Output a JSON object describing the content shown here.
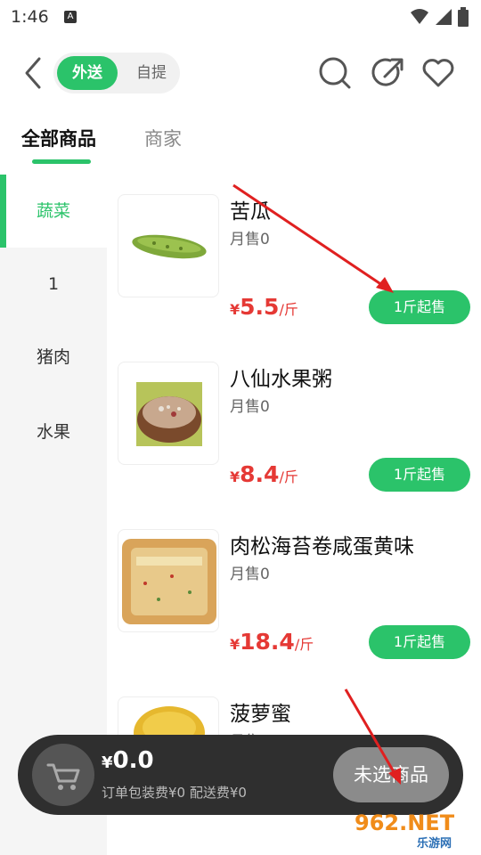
{
  "status_bar": {
    "time": "1:46",
    "notification_icon": "A",
    "icons": [
      "wifi-icon",
      "signal-icon",
      "battery-icon"
    ]
  },
  "header": {
    "toggle": {
      "active_label": "外送",
      "inactive_label": "自提"
    },
    "icons": [
      "back-icon",
      "search-icon",
      "share-icon",
      "heart-icon"
    ]
  },
  "tabs": {
    "all_goods": "全部商品",
    "merchant": "商家"
  },
  "sidebar": {
    "categories": [
      {
        "label": "蔬菜",
        "active": true
      },
      {
        "label": "1",
        "active": false
      },
      {
        "label": "猪肉",
        "active": false
      },
      {
        "label": "水果",
        "active": false
      }
    ]
  },
  "products": [
    {
      "name": "苦瓜",
      "sales": "月售0",
      "price_symbol": "¥",
      "price": "5.5",
      "unit": "/斤",
      "button": "1斤起售"
    },
    {
      "name": "八仙水果粥",
      "sales": "月售0",
      "price_symbol": "¥",
      "price": "8.4",
      "unit": "/斤",
      "button": "1斤起售"
    },
    {
      "name": "肉松海苔卷咸蛋黄味",
      "sales": "月售0",
      "price_symbol": "¥",
      "price": "18.4",
      "unit": "/斤",
      "button": "1斤起售"
    },
    {
      "name": "菠萝蜜",
      "sales": "月售0"
    }
  ],
  "cart": {
    "price_symbol": "¥",
    "total": "0.0",
    "fees": "订单包装费¥0  配送费¥0",
    "button": "未选商品"
  },
  "watermark": {
    "brand": "962.NET",
    "sub": "乐游网"
  },
  "colors": {
    "accent": "#2bc36a",
    "price": "#e53935",
    "cart_bar": "#2f2f2f",
    "arrow": "#e02020"
  }
}
